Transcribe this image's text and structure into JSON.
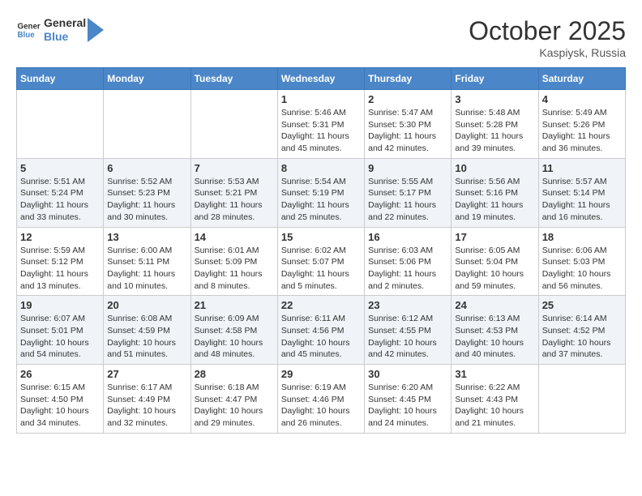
{
  "header": {
    "logo_line1": "General",
    "logo_line2": "Blue",
    "month": "October 2025",
    "location": "Kaspiysk, Russia"
  },
  "days_of_week": [
    "Sunday",
    "Monday",
    "Tuesday",
    "Wednesday",
    "Thursday",
    "Friday",
    "Saturday"
  ],
  "weeks": [
    [
      {
        "day": "",
        "info": ""
      },
      {
        "day": "",
        "info": ""
      },
      {
        "day": "",
        "info": ""
      },
      {
        "day": "1",
        "info": "Sunrise: 5:46 AM\nSunset: 5:31 PM\nDaylight: 11 hours and 45 minutes."
      },
      {
        "day": "2",
        "info": "Sunrise: 5:47 AM\nSunset: 5:30 PM\nDaylight: 11 hours and 42 minutes."
      },
      {
        "day": "3",
        "info": "Sunrise: 5:48 AM\nSunset: 5:28 PM\nDaylight: 11 hours and 39 minutes."
      },
      {
        "day": "4",
        "info": "Sunrise: 5:49 AM\nSunset: 5:26 PM\nDaylight: 11 hours and 36 minutes."
      }
    ],
    [
      {
        "day": "5",
        "info": "Sunrise: 5:51 AM\nSunset: 5:24 PM\nDaylight: 11 hours and 33 minutes."
      },
      {
        "day": "6",
        "info": "Sunrise: 5:52 AM\nSunset: 5:23 PM\nDaylight: 11 hours and 30 minutes."
      },
      {
        "day": "7",
        "info": "Sunrise: 5:53 AM\nSunset: 5:21 PM\nDaylight: 11 hours and 28 minutes."
      },
      {
        "day": "8",
        "info": "Sunrise: 5:54 AM\nSunset: 5:19 PM\nDaylight: 11 hours and 25 minutes."
      },
      {
        "day": "9",
        "info": "Sunrise: 5:55 AM\nSunset: 5:17 PM\nDaylight: 11 hours and 22 minutes."
      },
      {
        "day": "10",
        "info": "Sunrise: 5:56 AM\nSunset: 5:16 PM\nDaylight: 11 hours and 19 minutes."
      },
      {
        "day": "11",
        "info": "Sunrise: 5:57 AM\nSunset: 5:14 PM\nDaylight: 11 hours and 16 minutes."
      }
    ],
    [
      {
        "day": "12",
        "info": "Sunrise: 5:59 AM\nSunset: 5:12 PM\nDaylight: 11 hours and 13 minutes."
      },
      {
        "day": "13",
        "info": "Sunrise: 6:00 AM\nSunset: 5:11 PM\nDaylight: 11 hours and 10 minutes."
      },
      {
        "day": "14",
        "info": "Sunrise: 6:01 AM\nSunset: 5:09 PM\nDaylight: 11 hours and 8 minutes."
      },
      {
        "day": "15",
        "info": "Sunrise: 6:02 AM\nSunset: 5:07 PM\nDaylight: 11 hours and 5 minutes."
      },
      {
        "day": "16",
        "info": "Sunrise: 6:03 AM\nSunset: 5:06 PM\nDaylight: 11 hours and 2 minutes."
      },
      {
        "day": "17",
        "info": "Sunrise: 6:05 AM\nSunset: 5:04 PM\nDaylight: 10 hours and 59 minutes."
      },
      {
        "day": "18",
        "info": "Sunrise: 6:06 AM\nSunset: 5:03 PM\nDaylight: 10 hours and 56 minutes."
      }
    ],
    [
      {
        "day": "19",
        "info": "Sunrise: 6:07 AM\nSunset: 5:01 PM\nDaylight: 10 hours and 54 minutes."
      },
      {
        "day": "20",
        "info": "Sunrise: 6:08 AM\nSunset: 4:59 PM\nDaylight: 10 hours and 51 minutes."
      },
      {
        "day": "21",
        "info": "Sunrise: 6:09 AM\nSunset: 4:58 PM\nDaylight: 10 hours and 48 minutes."
      },
      {
        "day": "22",
        "info": "Sunrise: 6:11 AM\nSunset: 4:56 PM\nDaylight: 10 hours and 45 minutes."
      },
      {
        "day": "23",
        "info": "Sunrise: 6:12 AM\nSunset: 4:55 PM\nDaylight: 10 hours and 42 minutes."
      },
      {
        "day": "24",
        "info": "Sunrise: 6:13 AM\nSunset: 4:53 PM\nDaylight: 10 hours and 40 minutes."
      },
      {
        "day": "25",
        "info": "Sunrise: 6:14 AM\nSunset: 4:52 PM\nDaylight: 10 hours and 37 minutes."
      }
    ],
    [
      {
        "day": "26",
        "info": "Sunrise: 6:15 AM\nSunset: 4:50 PM\nDaylight: 10 hours and 34 minutes."
      },
      {
        "day": "27",
        "info": "Sunrise: 6:17 AM\nSunset: 4:49 PM\nDaylight: 10 hours and 32 minutes."
      },
      {
        "day": "28",
        "info": "Sunrise: 6:18 AM\nSunset: 4:47 PM\nDaylight: 10 hours and 29 minutes."
      },
      {
        "day": "29",
        "info": "Sunrise: 6:19 AM\nSunset: 4:46 PM\nDaylight: 10 hours and 26 minutes."
      },
      {
        "day": "30",
        "info": "Sunrise: 6:20 AM\nSunset: 4:45 PM\nDaylight: 10 hours and 24 minutes."
      },
      {
        "day": "31",
        "info": "Sunrise: 6:22 AM\nSunset: 4:43 PM\nDaylight: 10 hours and 21 minutes."
      },
      {
        "day": "",
        "info": ""
      }
    ]
  ]
}
